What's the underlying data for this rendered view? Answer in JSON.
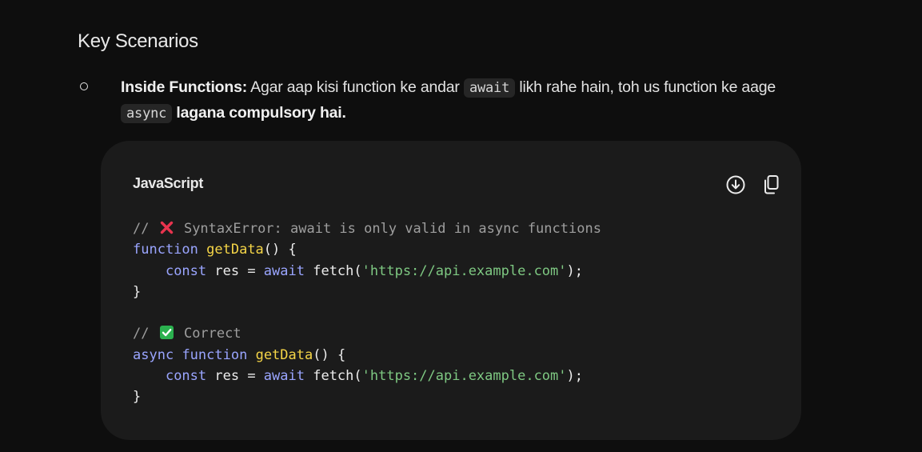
{
  "section": {
    "heading": "Key Scenarios"
  },
  "bullet": {
    "label": "Inside Functions:",
    "text_part1": " Agar aap kisi function ke andar ",
    "code1": "await",
    "text_part2": " likh rahe hain, toh us function ke aage ",
    "code2": "async",
    "text_part3_bold": " lagana compulsory hai."
  },
  "code_block": {
    "language": "JavaScript",
    "download_icon": "download-icon",
    "copy_icon": "copy-icon",
    "lines": {
      "l1_prefix": "// ",
      "l1_emoji": "cross-mark-emoji",
      "l1_text": " SyntaxError: await is only valid in async functions",
      "l2_kw": "function",
      "l2_fn": "getData",
      "l2_rest": "() {",
      "l3_indent": "    ",
      "l3_kw": "const",
      "l3_mid": " res = ",
      "l3_kw2": "await",
      "l3_call": " fetch(",
      "l3_str": "'https://api.example.com'",
      "l3_end": ");",
      "l4": "}",
      "l6_prefix": "// ",
      "l6_emoji": "check-mark-emoji",
      "l6_text": " Correct",
      "l7_kw": "async",
      "l7_kw2": "function",
      "l7_fn": "getData",
      "l7_rest": "() {",
      "l8_indent": "    ",
      "l8_kw": "const",
      "l8_mid": " res = ",
      "l8_kw2": "await",
      "l8_call": " fetch(",
      "l8_str": "'https://api.example.com'",
      "l8_end": ");",
      "l9": "}"
    }
  },
  "colors": {
    "background": "#0e0e0e",
    "card": "#1b1b1b",
    "keyword": "#9aa5ff",
    "function_name": "#f5d547",
    "string": "#7ec882",
    "comment": "#9e9e9e",
    "cross": "#e8344e",
    "check": "#2bb14f"
  }
}
